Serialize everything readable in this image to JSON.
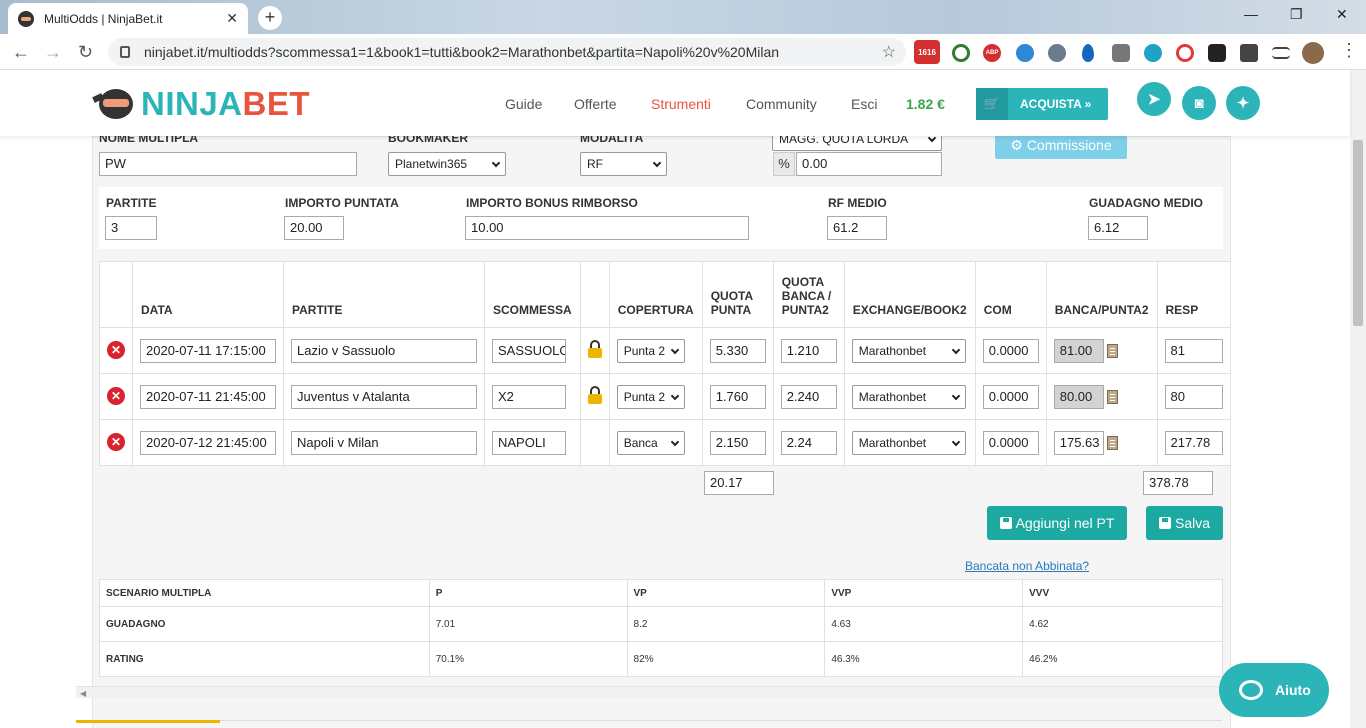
{
  "browser": {
    "tab_title": "MultiOdds | NinjaBet.it",
    "tab_close": "✕",
    "new_tab": "+",
    "url": "ninjabet.it/multiodds?scommessa1=1&book1=tutti&book2=Marathonbet&partita=Napoli%20v%20Milan",
    "win_min": "—",
    "win_max": "❐",
    "win_close": "✕",
    "nav_back": "←",
    "nav_forward": "→",
    "nav_reload": "↻",
    "star": "☆",
    "extensions": [
      "gmail-counter-icon",
      "refresh-ext-icon",
      "abp-icon",
      "p-ext-icon",
      "lamp-ext-icon",
      "drop-ext-icon",
      "code-ext-icon",
      "m-ext-icon",
      "shield-ext-icon",
      "mask-ext-icon",
      "puzzle-icon",
      "queue-icon",
      "avatar"
    ],
    "gmail_badge": "1616",
    "abp_label": "ABP"
  },
  "site": {
    "logo_part1": "NINJA",
    "logo_part2": "BET",
    "nav": [
      "Guide",
      "Offerte",
      "Strumenti",
      "Community",
      "Esci"
    ],
    "active_nav": "Strumenti",
    "credit": "1.82 €",
    "buy_label": "ACQUISTA »",
    "cart_icon": "🛒",
    "social": [
      "telegram-icon",
      "instagram-icon",
      "twitter-icon"
    ],
    "social_glyphs": [
      "➤",
      "◙",
      "✦"
    ],
    "accent_color": "#2bb5b8",
    "brand_red": "#e8553f"
  },
  "form": {
    "nome_label": "NOME MULTIPLA",
    "nome_value": "PW",
    "bookmaker_label": "BOOKMAKER",
    "bookmaker_value": "Planetwin365",
    "modalita_label": "MODALITÀ",
    "modalita_value": "RF",
    "quota_mode_value": "MAGG. QUOTA LORDA",
    "pct_symbol": "%",
    "pct_value": "0.00",
    "commission_label": "Commissione",
    "commission_icon": "⚙"
  },
  "summary": {
    "partite_label": "PARTITE",
    "partite_value": "3",
    "puntata_label": "IMPORTO PUNTATA",
    "puntata_value": "20.00",
    "bonus_label": "IMPORTO BONUS RIMBORSO",
    "bonus_value": "10.00",
    "rf_label": "RF MEDIO",
    "rf_value": "61.2",
    "guadagno_label": "GUADAGNO MEDIO",
    "guadagno_value": "6.12"
  },
  "matches": {
    "headers": [
      "",
      "DATA",
      "PARTITE",
      "SCOMMESSA",
      "",
      "COPERTURA",
      "QUOTA PUNTA",
      "QUOTA BANCA / PUNTA2",
      "EXCHANGE/BOOK2",
      "COM",
      "BANCA/PUNTA2",
      "RESP"
    ],
    "delete_glyph": "✕",
    "rows": [
      {
        "data": "2020-07-11 17:15:00",
        "partita": "Lazio v Sassuolo",
        "scommessa": "SASSUOLO",
        "locked": true,
        "copertura": "Punta 2",
        "quota_punta": "5.330",
        "quota_banca": "1.210",
        "exchange": "Marathonbet",
        "com": "0.0000",
        "banca": "81.00",
        "banca_grey": true,
        "resp": "81"
      },
      {
        "data": "2020-07-11 21:45:00",
        "partita": "Juventus v Atalanta",
        "scommessa": "X2",
        "locked": true,
        "copertura": "Punta 2",
        "quota_punta": "1.760",
        "quota_banca": "2.240",
        "exchange": "Marathonbet",
        "com": "0.0000",
        "banca": "80.00",
        "banca_grey": true,
        "resp": "80"
      },
      {
        "data": "2020-07-12 21:45:00",
        "partita": "Napoli v Milan",
        "scommessa": "NAPOLI",
        "locked": false,
        "copertura": "Banca",
        "quota_punta": "2.150",
        "quota_banca": "2.24",
        "exchange": "Marathonbet",
        "com": "0.0000",
        "banca": "175.63",
        "banca_grey": false,
        "resp": "217.78"
      }
    ],
    "total_quota": "20.17",
    "total_resp": "378.78"
  },
  "actions": {
    "add_pt": "Aggiungi nel PT",
    "save": "Salva",
    "unmatched_link": "Bancata non Abbinata?"
  },
  "scenario": {
    "headers": [
      "SCENARIO MULTIPLA",
      "P",
      "VP",
      "VVP",
      "VVV"
    ],
    "rows": [
      {
        "label": "GUADAGNO",
        "values": [
          "7.01",
          "8.2",
          "4.63",
          "4.62"
        ]
      },
      {
        "label": "RATING",
        "values": [
          "70.1%",
          "82%",
          "46.3%",
          "46.2%"
        ]
      }
    ]
  },
  "help": {
    "label": "Aiuto"
  },
  "scroll_arrow": "◀"
}
